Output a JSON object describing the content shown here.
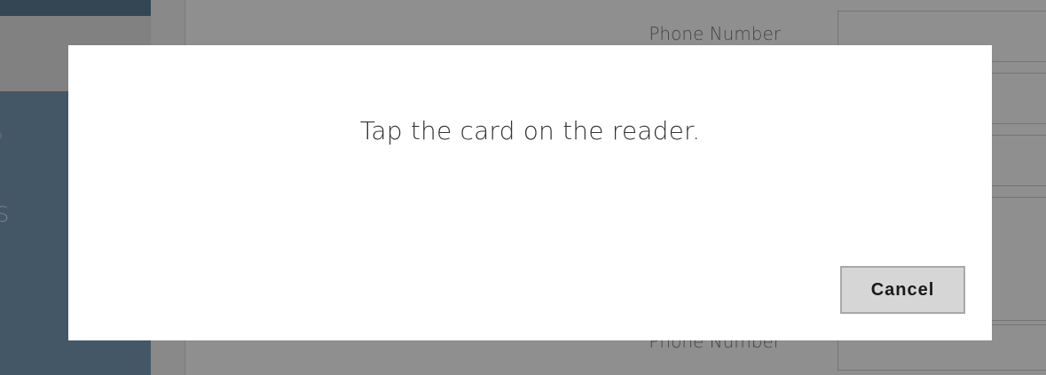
{
  "background": {
    "fields": {
      "top_label": "Phone Number",
      "bottom_label": "Phone Number"
    },
    "sidebar": {
      "glyph_1": "o",
      "glyph_2": "S"
    }
  },
  "modal": {
    "message": "Tap the card on the reader.",
    "cancel_label": "Cancel"
  },
  "colors": {
    "sidebar": "#7a9cb6",
    "overlay": "rgba(0,0,0,0.44)",
    "modal_bg": "#ffffff",
    "button_bg": "#d6d6d6"
  }
}
